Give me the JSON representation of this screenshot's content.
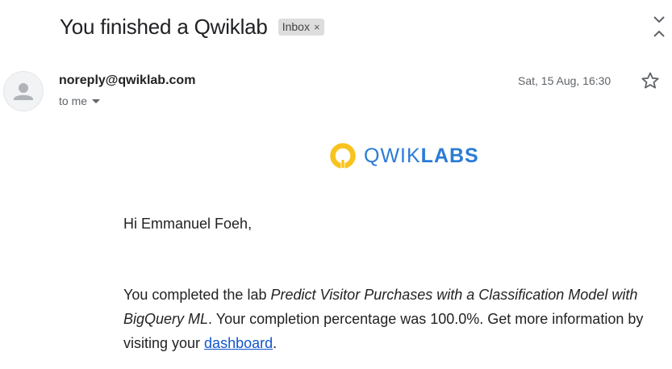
{
  "email": {
    "subject": "You finished a Qwiklab",
    "label": "Inbox",
    "label_remove": "×",
    "sender": "noreply@qwiklab.com",
    "recipient": "to me",
    "date": "Sat, 15 Aug, 16:30",
    "icons": {
      "avatar": "person-avatar-icon",
      "expand": "expand-collapse-icon",
      "star": "star-outline-icon",
      "caret": "caret-down-icon"
    }
  },
  "body": {
    "logo": {
      "part1": "QWIK",
      "part2": "LABS",
      "accent": "#f9c31f",
      "brand": "#2a7bd6"
    },
    "greeting": "Hi Emmanuel Foeh,",
    "msg_prefix": "You completed the lab ",
    "lab_name": "Predict Visitor Purchases with a Classification Model with BigQuery ML",
    "msg_middle": ". Your completion percentage was 100.0%. Get more information by visiting your ",
    "link_text": "dashboard",
    "msg_suffix": ".",
    "link_color": "#1155cc"
  }
}
